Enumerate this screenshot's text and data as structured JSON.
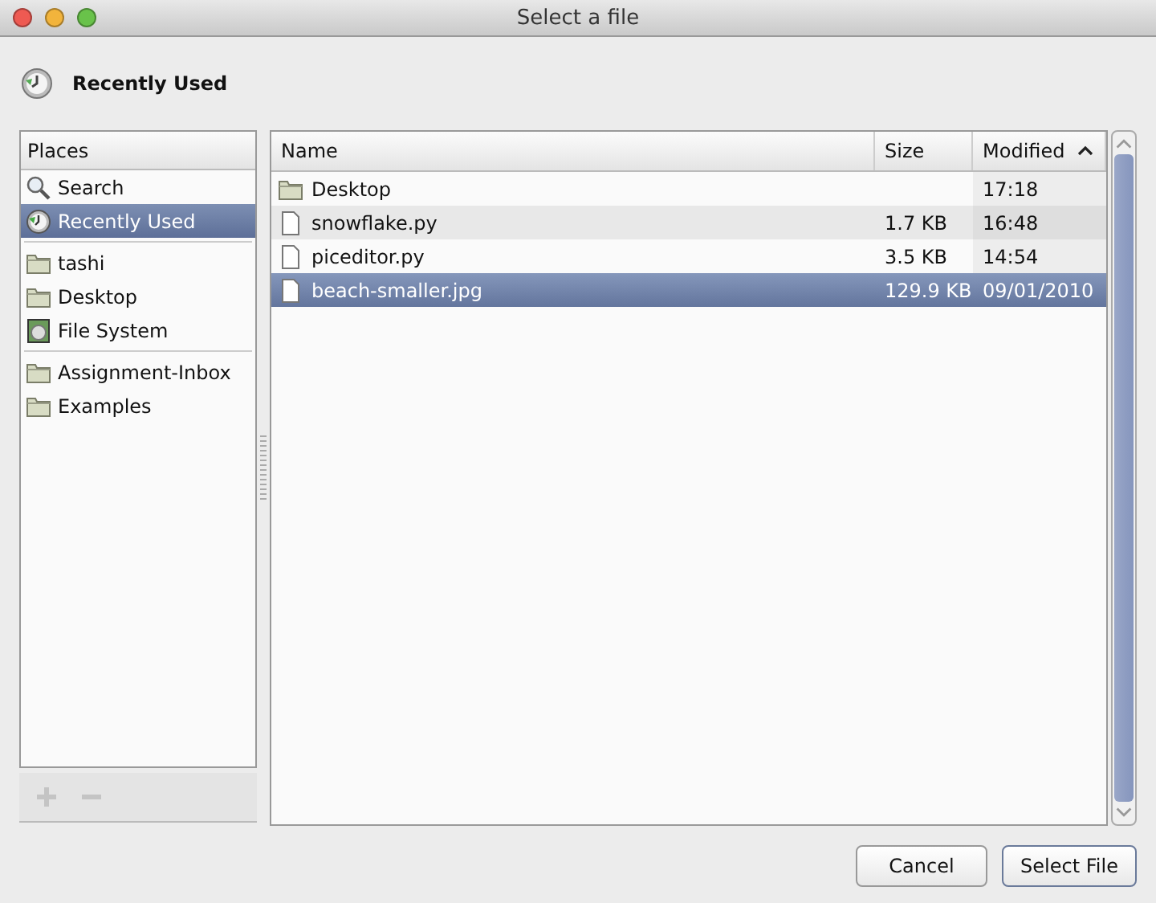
{
  "window": {
    "title": "Select a file"
  },
  "location": {
    "label": "Recently Used"
  },
  "places": {
    "heading": "Places",
    "groups": [
      [
        {
          "label": "Search",
          "kind": "search",
          "selected": false
        },
        {
          "label": "Recently Used",
          "kind": "recent",
          "selected": true
        }
      ],
      [
        {
          "label": "tashi",
          "kind": "folder",
          "selected": false
        },
        {
          "label": "Desktop",
          "kind": "folder",
          "selected": false
        },
        {
          "label": "File System",
          "kind": "drive",
          "selected": false
        }
      ],
      [
        {
          "label": "Assignment-Inbox",
          "kind": "folder",
          "selected": false
        },
        {
          "label": "Examples",
          "kind": "folder",
          "selected": false
        }
      ]
    ]
  },
  "columns": [
    {
      "label": "Name",
      "sorted": false
    },
    {
      "label": "Size",
      "sorted": false
    },
    {
      "label": "Modified",
      "sorted": true
    }
  ],
  "files": [
    {
      "name": "Desktop",
      "kind": "folder",
      "modified": "17:18",
      "selected": false
    },
    {
      "name": "snowflake.py",
      "kind": "file",
      "size": "1.7 KB",
      "modified": "16:48",
      "selected": false
    },
    {
      "name": "piceditor.py",
      "kind": "file",
      "size": "3.5 KB",
      "modified": "14:54",
      "selected": false
    },
    {
      "name": "beach-smaller.jpg",
      "kind": "file",
      "size": "129.9 KB",
      "modified": "09/01/2010",
      "selected": true
    }
  ],
  "buttons": [
    "Cancel",
    "Select File"
  ]
}
